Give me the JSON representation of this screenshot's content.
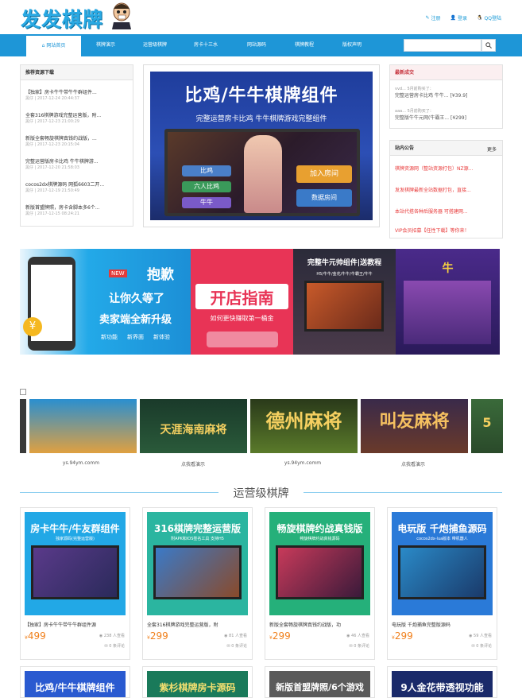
{
  "header": {
    "logo_text": "发发棋牌",
    "links": [
      "注册",
      "登录",
      "QQ登陆"
    ]
  },
  "nav": {
    "items": [
      "网站首页",
      "棋牌演示",
      "运营级棋牌",
      "房卡十三水",
      "网站源码",
      "棋牌教程",
      "版权声明"
    ],
    "active_index": 0
  },
  "search": {
    "placeholder": ""
  },
  "downloads": {
    "title": "推荐资源下载",
    "items": [
      {
        "title": "【独家】房卡牛牛带牛牛群组件...",
        "date": "黑仔 | 2017-12-24 20:44:37"
      },
      {
        "title": "全套316棋牌游戏完整运营版，附...",
        "date": "黑仔 | 2017-12-23 21:00:29"
      },
      {
        "title": "新版全套畅旋棋牌真钱约战版，...",
        "date": "黑仔 | 2017-12-23 20:15:04"
      },
      {
        "title": "完整运营版房卡比鸡 牛牛棋牌游...",
        "date": "黑仔 | 2017-12-20 21:58:03"
      },
      {
        "title": "cocos2dx棋牌源码 网狐6603二开...",
        "date": "黑仔 | 2017-12-19 21:50:49"
      },
      {
        "title": "新版首盟牌照，房卡含脚本多6个...",
        "date": "黑仔 | 2017-12-15 08:24:21"
      }
    ]
  },
  "banner": {
    "title": "比鸡/牛牛棋牌组件",
    "subtitle": "完整运营房卡比鸡 牛牛棋牌游戏完整组件",
    "buttons": [
      "比鸡",
      "六人比鸡",
      "牛牛",
      "加入房间",
      "数据房间"
    ]
  },
  "news": {
    "title": "最新成交",
    "items": [
      {
        "user": "vvd...",
        "time": "5月前购买了：",
        "text": "完整运营房卡比鸡 牛牛...",
        "price": "[¥39.9]"
      },
      {
        "user": "aaa...",
        "time": "5月前购买了：",
        "text": "完整版牛牛元网(牛霸王...",
        "price": "[¥299]"
      }
    ]
  },
  "notice": {
    "title": "站内公告",
    "more": "更多",
    "items": [
      "棋牌资源网（整站资源打包）NZ源...",
      "发发棋牌最新全站数据打包，直接...",
      "本站代搭各种后服务器 可搭建网...",
      "VIP会员招募【任性下载】等你来！"
    ]
  },
  "promo": {
    "p1": {
      "line1": "抱歉",
      "line2": "让你久等了",
      "line3": "卖家端全新升级",
      "badge": "NEW",
      "tags": [
        "新功能",
        "新界面",
        "新体验"
      ]
    },
    "p2": {
      "title": "开店指南",
      "sub": "如何更快赚取第一桶金"
    },
    "p3": {
      "title": "完整牛元帅组件|送教程",
      "sub": "H5/牛牛/金花/牛牛/牛霸王/牛牛"
    },
    "p4": {
      "title": "牛"
    }
  },
  "slider": {
    "captions": [
      "ys.94ym.comm",
      "点我看演示",
      "ys.94ym.comm",
      "点我看演示"
    ],
    "titles": [
      "",
      "天涯海南麻将",
      "德州麻将",
      "叫友麻将",
      "5"
    ]
  },
  "section": {
    "title": "运营级棋牌"
  },
  "cards": [
    {
      "img_title": "房卡牛牛/牛友群组件",
      "img_sub": "独家源码(完整运营版)",
      "title": "【独家】房卡牛牛带牛牛群组件源",
      "price": "499",
      "views": "238 人查看",
      "comments": "0 条评论"
    },
    {
      "img_title": "316棋牌完整运营版",
      "img_sub": "附APK和IOS签名工具 支持H5",
      "title": "全套316棋牌游戏完整运营版，附",
      "price": "299",
      "views": "81 人查看",
      "comments": "0 条评论"
    },
    {
      "img_title": "畅旋棋牌约战真钱版",
      "img_sub": "畅旋棋牌约战真钱源码",
      "title": "新版全套畅旋棋牌真钱约战版，功",
      "price": "299",
      "views": "46 人查看",
      "comments": "0 条评论"
    },
    {
      "img_title": "电玩版 千炮捕鱼源码",
      "img_sub": "cocos2dx-lua版本 带机器人",
      "title": "电玩版 千炮捕鱼完整版源码",
      "price": "299",
      "views": "59 人查看",
      "comments": "0 条评论"
    }
  ],
  "cards2": [
    {
      "img_title": "比鸡/牛牛棋牌组件"
    },
    {
      "img_title": "紫杉棋牌房卡源码"
    },
    {
      "img_title": "新版首盟牌照/6个游戏"
    },
    {
      "img_title": "9人金花带透视功能"
    }
  ]
}
